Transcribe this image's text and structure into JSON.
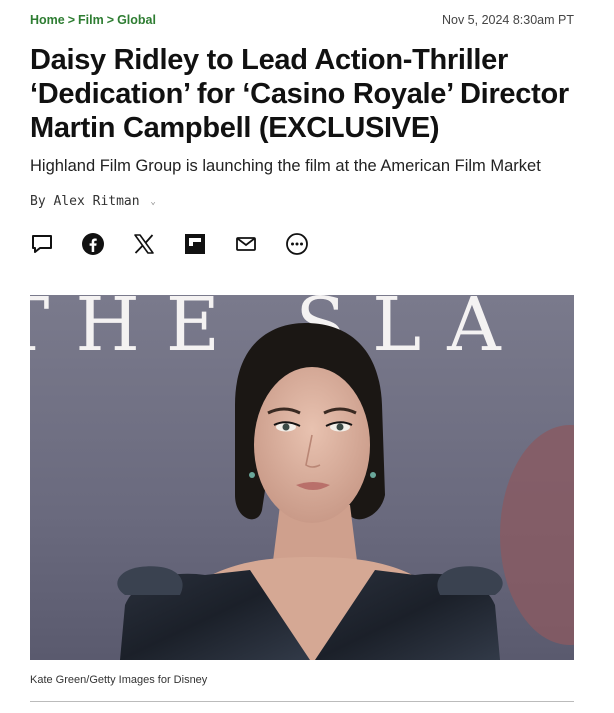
{
  "breadcrumb": {
    "items": [
      "Home",
      "Film",
      "Global"
    ],
    "separator": ">"
  },
  "date": "Nov 5, 2024 8:30am PT",
  "headline": "Daisy Ridley to Lead Action-Thriller ‘Dedication’ for ‘Casino Royale’ Director Martin Campbell (EXCLUSIVE)",
  "dek": "Highland Film Group is launching the film at the American Film Market",
  "byline": {
    "prefix": "By",
    "author": "Alex Ritman"
  },
  "share_icons": [
    "comment-icon",
    "facebook-icon",
    "x-icon",
    "flipboard-icon",
    "email-icon",
    "more-icon"
  ],
  "photo": {
    "backdrop_text": "THE SLA"
  },
  "caption": "Kate Green/Getty Images for Disney",
  "colors": {
    "breadcrumb": "#2e7d32",
    "backdrop": "#6f6e82",
    "dress": "#222832"
  }
}
